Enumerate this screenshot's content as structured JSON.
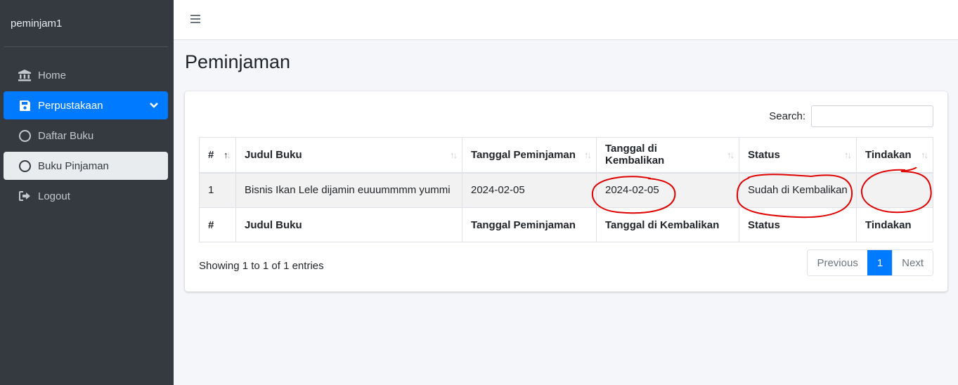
{
  "sidebar": {
    "brand": "peminjam1",
    "items": [
      {
        "label": "Home",
        "icon": "bank-icon"
      },
      {
        "label": "Perpustakaan",
        "icon": "save-icon"
      },
      {
        "label": "Daftar Buku",
        "icon": "circle-icon"
      },
      {
        "label": "Buku Pinjaman",
        "icon": "circle-icon"
      },
      {
        "label": "Logout",
        "icon": "sign-out-icon"
      }
    ]
  },
  "page": {
    "title": "Peminjaman"
  },
  "search": {
    "label": "Search:",
    "value": ""
  },
  "table": {
    "headers": [
      "#",
      "Judul Buku",
      "Tanggal Peminjaman",
      "Tanggal di Kembalikan",
      "Status",
      "Tindakan"
    ],
    "rows": [
      [
        "1",
        "Bisnis Ikan Lele dijamin euuummmm yummi",
        "2024-02-05",
        "2024-02-05",
        "Sudah di Kembalikan",
        ""
      ]
    ]
  },
  "footer": {
    "info": "Showing 1 to 1 of 1 entries"
  },
  "pagination": {
    "previous": "Previous",
    "current": "1",
    "next": "Next"
  },
  "colors": {
    "accent": "#007bff",
    "sidebar": "#343a40",
    "annotation": "#e00000"
  }
}
